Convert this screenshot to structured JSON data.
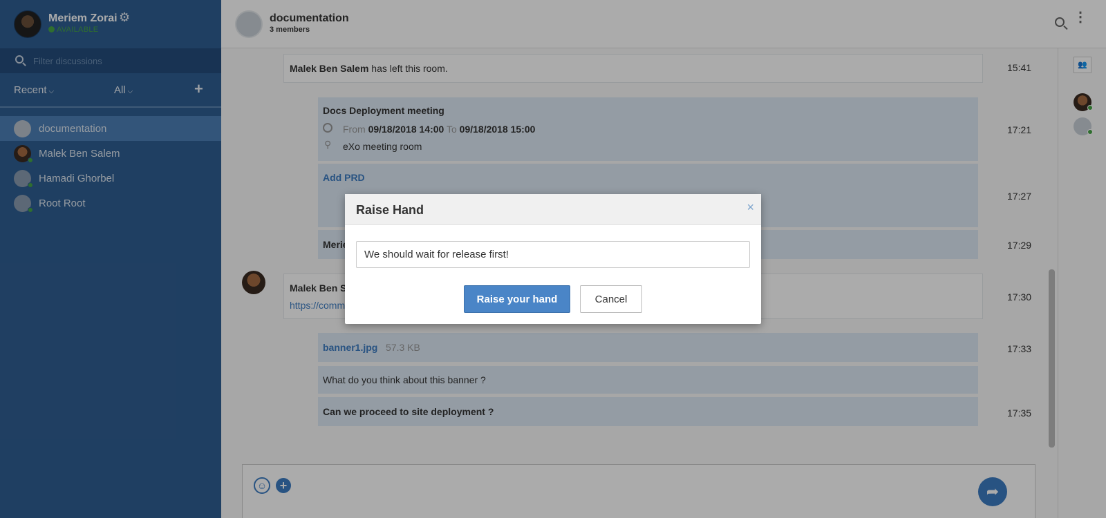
{
  "user": {
    "name": "Meriem Zorai",
    "status": "AVAILABLE"
  },
  "filter": {
    "placeholder": "Filter discussions"
  },
  "filters": {
    "recent": "Recent",
    "all": "All",
    "add": "+"
  },
  "rooms": [
    {
      "label": "documentation"
    },
    {
      "label": "Malek Ben Salem"
    },
    {
      "label": "Hamadi Ghorbel"
    },
    {
      "label": "Root Root"
    }
  ],
  "header": {
    "title": "documentation",
    "members": "3 members"
  },
  "messages": {
    "m1": {
      "author": "Malek Ben Salem",
      "text": " has left this room.",
      "time": "15:41"
    },
    "m2": {
      "title": "Docs Deployment meeting",
      "from_label": "From",
      "from": "09/18/2018 14:00",
      "to_label": "To",
      "to": "09/18/2018 15:00",
      "location": "eXo meeting room",
      "time": "17:21"
    },
    "m3": {
      "title": "Add PRD",
      "time": "17:27"
    },
    "m4": {
      "author_partial": "Merie",
      "time": "17:29"
    },
    "m5": {
      "author_partial": "Malek Ben S",
      "link_partial": "https://comm",
      "time": "17:30"
    },
    "m6": {
      "file": "banner1.jpg",
      "size": "57.3 KB",
      "time": "17:33"
    },
    "m7": {
      "text": "What do you think about this banner ?"
    },
    "m8": {
      "text": "Can we proceed to site deployment ?",
      "time": "17:35"
    }
  },
  "modal": {
    "title": "Raise Hand",
    "close": "×",
    "input_value": "We should wait for release first!",
    "submit": "Raise your hand",
    "cancel": "Cancel"
  }
}
